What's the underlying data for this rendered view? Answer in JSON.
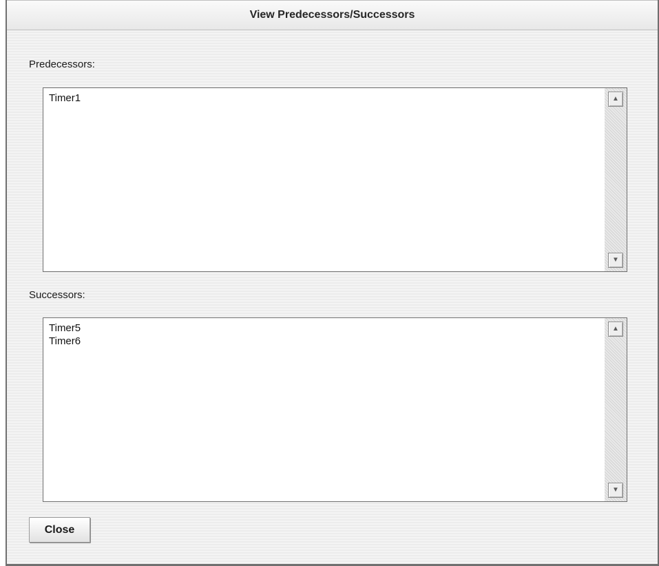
{
  "dialog": {
    "title": "View Predecessors/Successors"
  },
  "predecessors": {
    "label": "Predecessors:",
    "items": [
      "Timer1"
    ]
  },
  "successors": {
    "label": "Successors:",
    "items": [
      "Timer5",
      "Timer6"
    ]
  },
  "buttons": {
    "close_label": "Close"
  },
  "icons": {
    "scroll_up": "scroll-up-arrow-icon",
    "scroll_down": "scroll-down-arrow-icon"
  }
}
